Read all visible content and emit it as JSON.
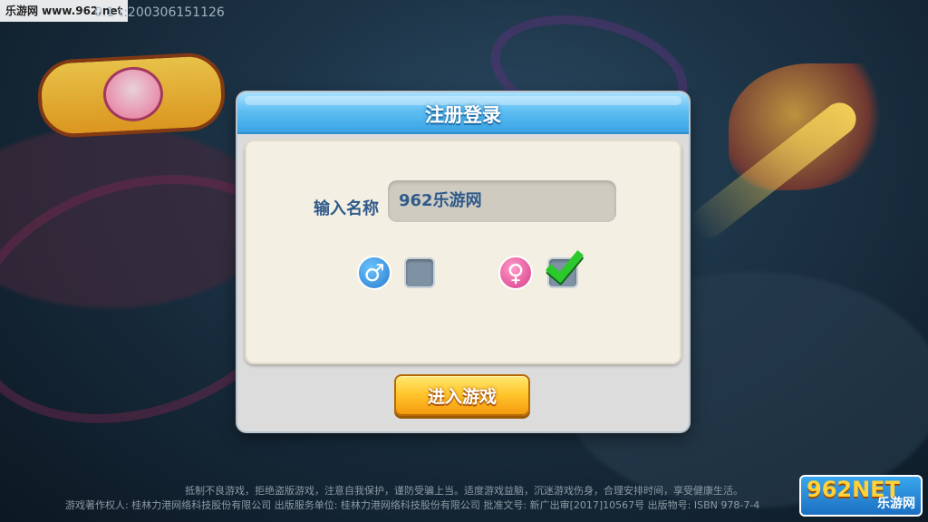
{
  "watermark": {
    "site": "乐游网 www.962.net"
  },
  "version": "0.1 t:200306151126",
  "dialog": {
    "title": "注册登录",
    "name_label": "输入名称",
    "name_value": "962乐游网",
    "male_symbol": "♂",
    "female_symbol": "♀",
    "male_checked": false,
    "female_checked": true,
    "enter_button": "进入游戏"
  },
  "footer": {
    "line1": "抵制不良游戏，拒绝盗版游戏，注意自我保护，谨防受骗上当。适度游戏益脑，沉迷游戏伤身，合理安排时间，享受健康生活。",
    "line2": "游戏著作权人: 桂林力港网络科技股份有限公司 出版服务单位: 桂林力港网络科技股份有限公司 批准文号: 新广出审[2017]10567号 出版物号: ISBN 978-7-4"
  },
  "corner_logo": {
    "big": "962NET",
    "small": "乐游网"
  },
  "icons": {
    "male": "male-symbol-icon",
    "female": "female-symbol-icon",
    "check": "checkmark-icon"
  }
}
